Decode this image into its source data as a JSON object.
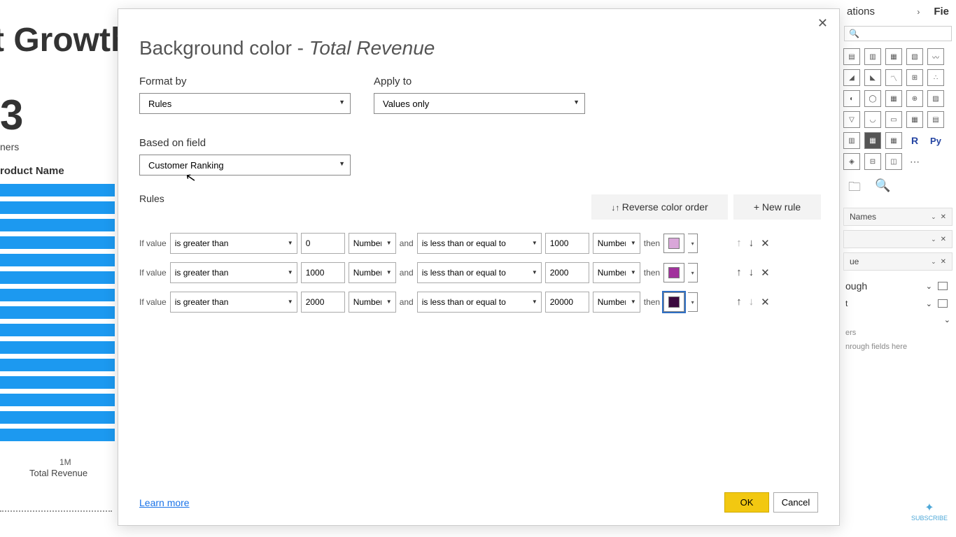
{
  "bg": {
    "title": "t Growth",
    "bignum": "3",
    "numsub": "ners",
    "colhead": "roduct Name",
    "axis1": "1M",
    "axis2": "Total Revenue"
  },
  "dialog": {
    "title_a": "Background color - ",
    "title_b": "Total Revenue",
    "format_by_label": "Format by",
    "format_by_value": "Rules",
    "apply_to_label": "Apply to",
    "apply_to_value": "Values only",
    "based_on_label": "Based on field",
    "based_on_value": "Customer Ranking",
    "rules_label": "Rules",
    "reverse_btn": "Reverse color order",
    "newrule_btn": "New rule",
    "learn": "Learn more",
    "ok": "OK",
    "cancel": "Cancel",
    "rows": [
      {
        "if": "If value",
        "op1": "is greater than",
        "v1": "0",
        "t1": "Number",
        "and": "and",
        "op2": "is less than or equal to",
        "v2": "1000",
        "t2": "Number",
        "then": "then",
        "color": "#d9a7d9"
      },
      {
        "if": "If value",
        "op1": "is greater than",
        "v1": "1000",
        "t1": "Number",
        "and": "and",
        "op2": "is less than or equal to",
        "v2": "2000",
        "t2": "Number",
        "then": "then",
        "color": "#a1329c"
      },
      {
        "if": "If value",
        "op1": "is greater than",
        "v1": "2000",
        "t1": "Number",
        "and": "and",
        "op2": "is less than or equal to",
        "v2": "20000",
        "t2": "Number",
        "then": "then",
        "color": "#3b0a3f"
      }
    ]
  },
  "rpanel": {
    "viz_header": "ations",
    "fields_header": "Fie",
    "names_field": "Names",
    "ue_field": "ue",
    "ough": "ough",
    "t": "t",
    "ers": "ers",
    "through_hint": "nrough fields here",
    "subscribe": "SUBSCRIBE"
  }
}
